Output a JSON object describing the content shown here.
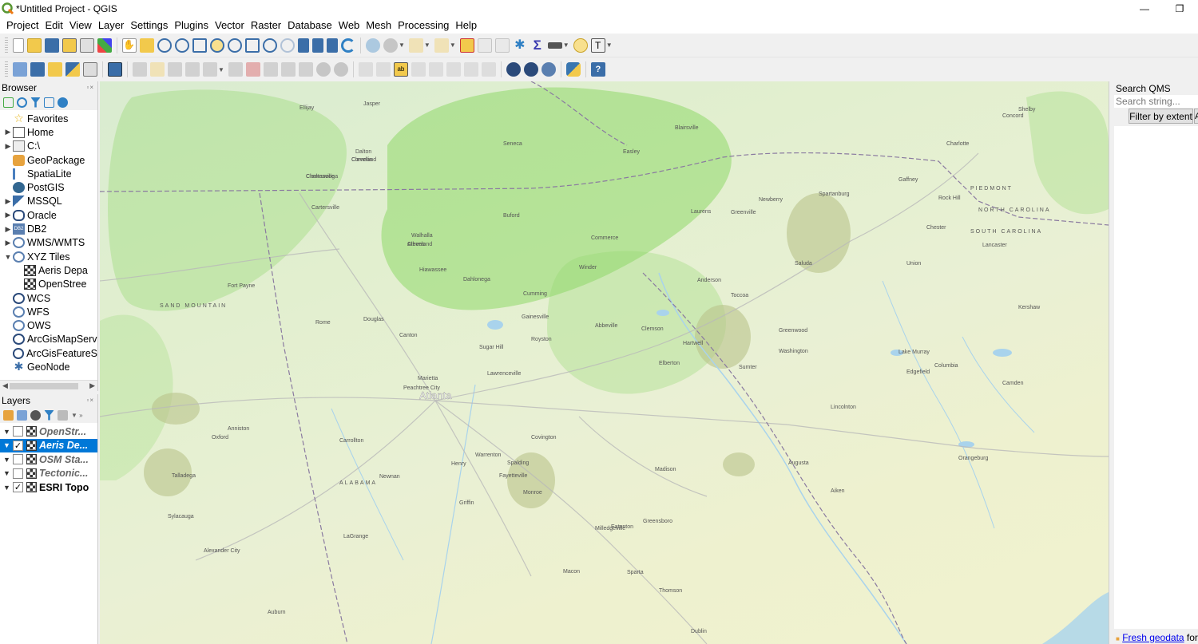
{
  "window": {
    "title": "*Untitled Project - QGIS",
    "min_label": "—",
    "max_label": "❐"
  },
  "menu": [
    "Project",
    "Edit",
    "View",
    "Layer",
    "Settings",
    "Plugins",
    "Vector",
    "Raster",
    "Database",
    "Web",
    "Mesh",
    "Processing",
    "Help"
  ],
  "browser": {
    "title": "Browser",
    "items": [
      {
        "label": "Favorites",
        "icon": "star-icon",
        "expand": ""
      },
      {
        "label": "Home",
        "icon": "home-icon",
        "expand": "▶"
      },
      {
        "label": "C:\\",
        "icon": "drive-icon",
        "expand": "▶"
      },
      {
        "label": "GeoPackage",
        "icon": "geopackage-icon",
        "expand": ""
      },
      {
        "label": "SpatiaLite",
        "icon": "spatialite-icon",
        "expand": ""
      },
      {
        "label": "PostGIS",
        "icon": "postgis-icon",
        "expand": ""
      },
      {
        "label": "MSSQL",
        "icon": "mssql-icon",
        "expand": "▶"
      },
      {
        "label": "Oracle",
        "icon": "oracle-icon",
        "expand": "▶"
      },
      {
        "label": "DB2",
        "icon": "db2-icon",
        "expand": "▶"
      },
      {
        "label": "WMS/WMTS",
        "icon": "wms-icon",
        "expand": "▶"
      },
      {
        "label": "XYZ Tiles",
        "icon": "xyz-icon",
        "expand": "▼"
      },
      {
        "label": "Aeris Depa",
        "icon": "tile-layer-icon",
        "expand": "",
        "child": true
      },
      {
        "label": "OpenStree",
        "icon": "tile-layer-icon",
        "expand": "",
        "child": true
      },
      {
        "label": "WCS",
        "icon": "wcs-icon",
        "expand": ""
      },
      {
        "label": "WFS",
        "icon": "wfs-icon",
        "expand": ""
      },
      {
        "label": "OWS",
        "icon": "ows-icon",
        "expand": ""
      },
      {
        "label": "ArcGisMapServ",
        "icon": "arcgis-map-icon",
        "expand": ""
      },
      {
        "label": "ArcGisFeatureS",
        "icon": "arcgis-feature-icon",
        "expand": ""
      },
      {
        "label": "GeoNode",
        "icon": "geonode-icon",
        "expand": ""
      }
    ]
  },
  "layers": {
    "title": "Layers",
    "items": [
      {
        "label": "OpenStr...",
        "checked": false,
        "selected": false
      },
      {
        "label": "Aeris De...",
        "checked": true,
        "selected": true
      },
      {
        "label": "OSM Sta...",
        "checked": false,
        "selected": false
      },
      {
        "label": "Tectonic...",
        "checked": false,
        "selected": false
      },
      {
        "label": "ESRI Topo",
        "checked": true,
        "selected": false
      }
    ]
  },
  "qms": {
    "title": "Search QMS",
    "search_placeholder": "Search string...",
    "filter_label": "Filter by extent",
    "extra_label": "A",
    "footer_link": "Fresh geodata",
    "footer_text": " for y"
  },
  "map": {
    "city_label": "Atlanta",
    "places": [
      "Chattanooga",
      "Cleveland",
      "Athens",
      "Atlanta",
      "Marietta",
      "Gainesville",
      "Anderson",
      "Greenville",
      "Spartanburg",
      "Charlotte",
      "Rock Hill",
      "Columbia",
      "Augusta",
      "Macon",
      "Milledgeville",
      "Newnan",
      "LaGrange",
      "Carrollton",
      "Rome",
      "Dalton",
      "Anniston",
      "Talladega",
      "Sylacauga",
      "Alexander City",
      "Auburn",
      "Greenwood",
      "Sumter",
      "Orangeburg",
      "Covington",
      "Griffin",
      "Shelby",
      "Concord",
      "Cartersville",
      "Lawrenceville",
      "Dublin",
      "Aiken",
      "Lake Murray",
      "Sugar Hill",
      "Buford",
      "PIEDMONT",
      "NORTH CAROLINA",
      "SOUTH CAROLINA",
      "ALABAMA",
      "SAND MOUNTAIN",
      "Fort Payne",
      "Oxford",
      "Canton",
      "Clemson",
      "Abbeville",
      "Camden",
      "Kershaw",
      "Lancaster",
      "Chester",
      "Union",
      "Gaffney",
      "Spalding",
      "Henry",
      "Monroe",
      "Madison",
      "Greensboro",
      "Eatonton",
      "Sparta",
      "Thomson",
      "Warrenton",
      "Fayetteville",
      "Peachtree City",
      "Douglas",
      "Jasper",
      "Ellijay",
      "Blairsville",
      "Toccoa",
      "Hartwell",
      "Elberton",
      "Washington",
      "Lincolnton",
      "Edgefield",
      "Saluda",
      "Newberry",
      "Laurens",
      "Easley",
      "Seneca",
      "Walhalla",
      "Hiawassee",
      "Dahlonega",
      "Cumming",
      "Winder",
      "Commerce",
      "Royston",
      "Clarkesville",
      "Cornelia",
      "Cleveland"
    ]
  },
  "colors": {
    "selection": "#0078d7",
    "map_green": "#8fd86a",
    "map_base": "#e6efd2",
    "state_line": "#8a7aa0",
    "road": "#b9b9b9",
    "water": "#a9d3ec"
  }
}
